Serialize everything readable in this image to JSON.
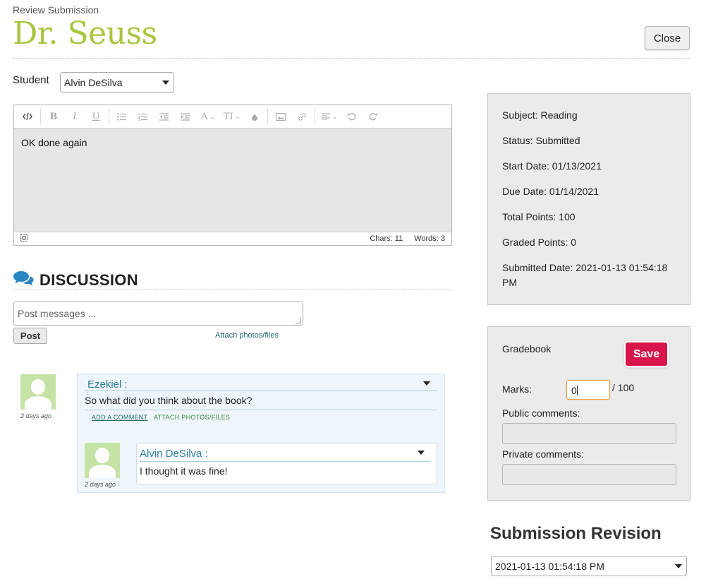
{
  "header": {
    "subtitle": "Review Submission",
    "title": "Dr. Seuss",
    "close_label": "Close"
  },
  "student": {
    "label": "Student",
    "selected": "Alvin DeSilva"
  },
  "editor": {
    "toolbar_icons": [
      "code-view-icon",
      "bold-icon",
      "italic-icon",
      "underline-icon",
      "bullet-list-icon",
      "numbered-list-icon",
      "outdent-icon",
      "indent-icon",
      "font-color-icon",
      "font-size-icon",
      "highlight-icon",
      "image-icon",
      "link-icon",
      "align-icon",
      "undo-icon",
      "redo-icon"
    ],
    "content": "OK done again",
    "chars": "Chars: 11",
    "words": "Words: 3"
  },
  "discussion": {
    "title": "DISCUSSION",
    "post_placeholder": "Post messages ...",
    "post_label": "Post",
    "attach_label": "Attach photos/files",
    "comments": [
      {
        "author": "Ezekiel :",
        "message": "So what did you think about the book?",
        "time": "2 days ago",
        "add_comment": "ADD A COMMENT",
        "attach": "ATTACH PHOTOS/FILES",
        "replies": [
          {
            "author": "Alvin DeSilva :",
            "message": "I thought it was fine!",
            "time": "2 days ago"
          }
        ]
      }
    ]
  },
  "info": {
    "subject": "Subject: Reading",
    "status": "Status: Submitted",
    "start_date": "Start Date: 01/13/2021",
    "due_date": "Due Date: 01/14/2021",
    "total_points": "Total Points: 100",
    "graded_points": "Graded Points: 0",
    "submitted_date": "Submitted Date: 2021-01-13 01:54:18 PM"
  },
  "gradebook": {
    "title": "Gradebook",
    "save_label": "Save",
    "marks_label": "Marks:",
    "marks_value": "0",
    "marks_total": "/ 100",
    "public_label": "Public comments:",
    "private_label": "Private comments:"
  },
  "revision": {
    "title": "Submission Revision",
    "selected": "2021-01-13 01:54:18 PM"
  },
  "colors": {
    "title_green": "#a7c63e",
    "save_red": "#d8154a",
    "link_teal": "#1f6a62",
    "author_blue": "#2a7fa0"
  }
}
